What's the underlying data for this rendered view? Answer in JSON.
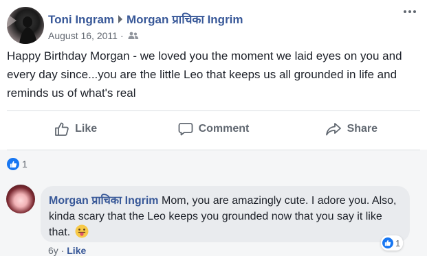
{
  "post": {
    "author": "Toni Ingram",
    "recipient": "Morgan प्राचिका Ingrim",
    "date": "August 16, 2011",
    "separator": "·",
    "privacy_icon": "friends-icon",
    "text": "Happy Birthday Morgan - we loved you the moment we laid eyes on you and every day since...you are the little Leo that keeps us all grounded in life and reminds us of what's real"
  },
  "actions": {
    "like": "Like",
    "comment": "Comment",
    "share": "Share"
  },
  "reactions": {
    "count": "1",
    "type": "like"
  },
  "comment": {
    "author": "Morgan प्राचिका Ingrim",
    "text": "Mom, you are amazingly cute. I adore you. Also, kinda scary that the Leo keeps you grounded now that you say it like that.",
    "emoji": "tongue-out-emoji",
    "reaction_count": "1",
    "time": "6y",
    "separator": "·",
    "like_label": "Like"
  },
  "colors": {
    "link_blue": "#385898",
    "like_blue": "#1877f2",
    "action_gray": "#606770",
    "bubble_gray": "#e9ebee",
    "panel_gray": "#f5f6f7"
  }
}
